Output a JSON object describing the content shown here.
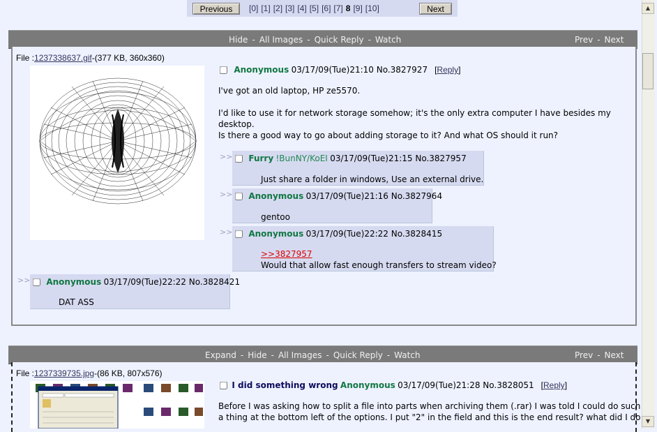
{
  "pager": {
    "previous": "Previous",
    "next": "Next",
    "pages": [
      "[0]",
      "[1]",
      "[2]",
      "[3]",
      "[4]",
      "[5]",
      "[6]",
      "[7]",
      "[8]",
      "[9]",
      "[10]"
    ],
    "current_page": "8"
  },
  "thread1": {
    "bar": {
      "hide": "Hide",
      "all_images": "All Images",
      "quick_reply": "Quick Reply",
      "watch": "Watch",
      "prev": "Prev",
      "next": "Next",
      "sep": "-"
    },
    "file": {
      "prefix": "File :",
      "name": "1237338637.gif",
      "meta": "-(377 KB, 360x360)"
    },
    "op": {
      "name": "Anonymous",
      "date": "03/17/09(Tue)21:10 No.3827927",
      "reply": "Reply",
      "lines": [
        "I've got an old laptop, HP ze5570.",
        "I'd like to use it for network storage somehow; it's the only extra computer I have besides my",
        "desktop.",
        "Is there a good way to go about adding storage to it? And what OS should it run?"
      ]
    },
    "replies": [
      {
        "name": "Furry",
        "trip": "!BunNY/KoEI",
        "date": "03/17/09(Tue)21:15 No.3827957",
        "text": "Just share a folder in windows, Use an external drive."
      },
      {
        "name": "Anonymous",
        "date": "03/17/09(Tue)21:16 No.3827964",
        "text": "gentoo"
      },
      {
        "name": "Anonymous",
        "date": "03/17/09(Tue)22:22 No.3828415",
        "quote": ">>3827957",
        "text": "Would that allow fast enough transfers to stream video?"
      },
      {
        "name": "Anonymous",
        "date": "03/17/09(Tue)22:22 No.3828421",
        "text": "DAT ASS"
      }
    ],
    "arrow": ">>"
  },
  "thread2": {
    "bar": {
      "expand": "Expand",
      "hide": "Hide",
      "all_images": "All Images",
      "quick_reply": "Quick Reply",
      "watch": "Watch",
      "prev": "Prev",
      "next": "Next",
      "sep": "-"
    },
    "file": {
      "prefix": "File :",
      "name": "1237339735.jpg",
      "meta": "-(86 KB, 807x576)"
    },
    "op": {
      "subject": "I did something wrong",
      "name": "Anonymous",
      "date": "03/17/09(Tue)21:28 No.3828051",
      "reply": "Reply",
      "lines": [
        "Before I was asking how to split a file into parts when archiving them (.rar) I was told I could do such",
        "a thing at the bottom left of the options. I put \"2\" in the field and this is the end result? what did I do"
      ]
    }
  },
  "scrollbar": {
    "up": "▲",
    "down": "▼"
  },
  "icons": {
    "thumbnail1": "torus-wireframe-image",
    "thumbnail2": "screenshot-thumbnail-image"
  }
}
